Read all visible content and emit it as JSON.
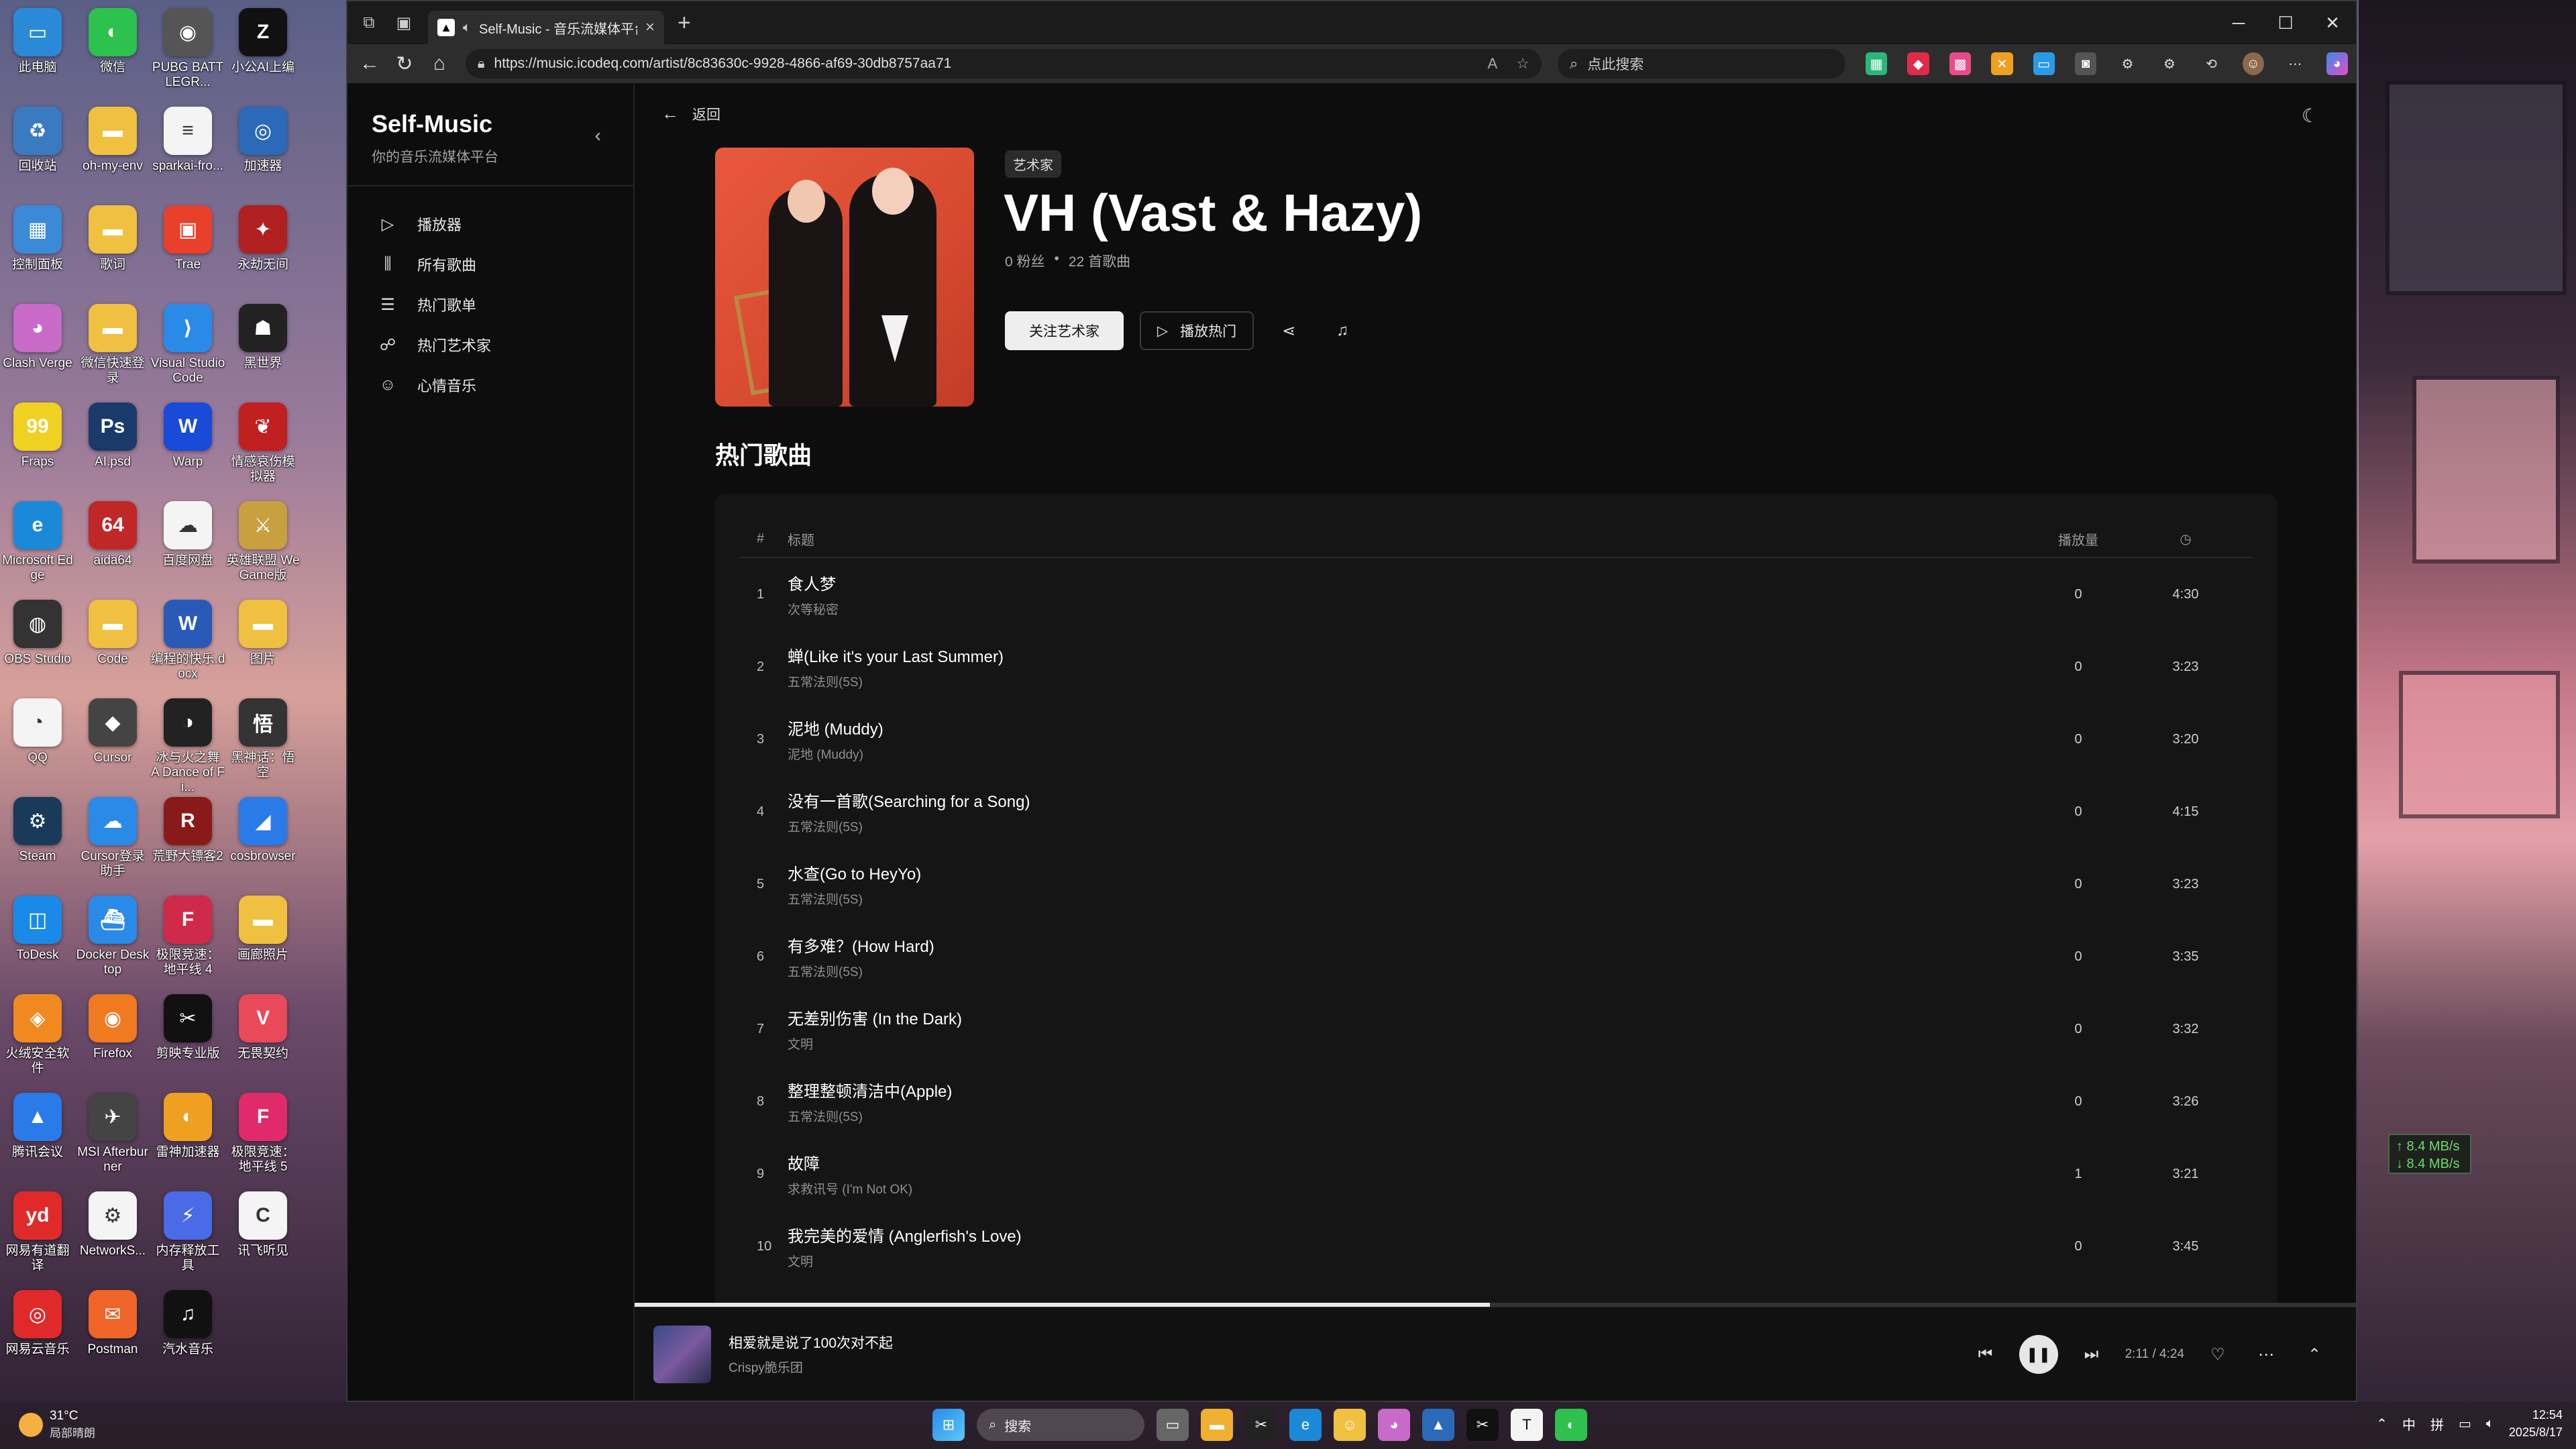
{
  "browser": {
    "tab_title": "Self-Music - 音乐流媒体平台",
    "url": "https://music.icodeq.com/artist/8c83630c-9928-4866-af69-30db8757aa71",
    "search_placeholder": "点此搜索"
  },
  "sidebar": {
    "brand": "Self-Music",
    "tagline": "你的音乐流媒体平台",
    "items": [
      {
        "label": "播放器"
      },
      {
        "label": "所有歌曲"
      },
      {
        "label": "热门歌单"
      },
      {
        "label": "热门艺术家"
      },
      {
        "label": "心情音乐"
      }
    ]
  },
  "artist": {
    "back_label": "返回",
    "badge": "艺术家",
    "name": "VH (Vast & Hazy)",
    "followers": "0 粉丝",
    "separator": "•",
    "song_count": "22 首歌曲",
    "follow_label": "关注艺术家",
    "play_label": "播放热门"
  },
  "songs": {
    "section_title": "热门歌曲",
    "headers": {
      "num": "#",
      "title": "标题",
      "plays": "播放量"
    },
    "rows": [
      {
        "num": "1",
        "title": "食人梦",
        "artist": "次等秘密",
        "plays": "0",
        "duration": "4:30"
      },
      {
        "num": "2",
        "title": "蝉(Like it's your Last Summer)",
        "artist": "五常法则(5S)",
        "plays": "0",
        "duration": "3:23"
      },
      {
        "num": "3",
        "title": "泥地 (Muddy)",
        "artist": "泥地 (Muddy)",
        "plays": "0",
        "duration": "3:20"
      },
      {
        "num": "4",
        "title": "没有一首歌(Searching for a Song)",
        "artist": "五常法则(5S)",
        "plays": "0",
        "duration": "4:15"
      },
      {
        "num": "5",
        "title": "水查(Go to HeyYo)",
        "artist": "五常法则(5S)",
        "plays": "0",
        "duration": "3:23"
      },
      {
        "num": "6",
        "title": "有多难？(How Hard)",
        "artist": "五常法则(5S)",
        "plays": "0",
        "duration": "3:35"
      },
      {
        "num": "7",
        "title": "无差别伤害 (In the Dark)",
        "artist": "文明",
        "plays": "0",
        "duration": "3:32"
      },
      {
        "num": "8",
        "title": "整理整顿清洁中(Apple)",
        "artist": "五常法则(5S)",
        "plays": "0",
        "duration": "3:26"
      },
      {
        "num": "9",
        "title": "故障",
        "artist": "求救讯号 (I'm Not OK)",
        "plays": "1",
        "duration": "3:21"
      },
      {
        "num": "10",
        "title": "我完美的爱情 (Anglerfish's Love)",
        "artist": "文明",
        "plays": "0",
        "duration": "3:45"
      }
    ]
  },
  "player": {
    "title": "相爱就是说了100次对不起",
    "artist": "Crispy脆乐团",
    "time": "2:11 / 4:24",
    "progress_fraction": 0.497
  },
  "desktop": {
    "icons": [
      {
        "label": "此电脑",
        "color": "#2a8ad8",
        "glyph": "▭"
      },
      {
        "label": "微信",
        "color": "#2dc14e",
        "glyph": "◐"
      },
      {
        "label": "PUBG BATTLEGR...",
        "color": "#555",
        "glyph": "◉"
      },
      {
        "label": "小公AI上编",
        "color": "#111",
        "glyph": "Z"
      },
      {
        "label": "回收站",
        "color": "#3a7ac0",
        "glyph": "♻"
      },
      {
        "label": "oh-my-env",
        "color": "#f0c040",
        "glyph": "▬"
      },
      {
        "label": "sparkai-fro...",
        "color": "#f4f4f4",
        "glyph": "≡"
      },
      {
        "label": "加速器",
        "color": "#2a6ab8",
        "glyph": "◎"
      },
      {
        "label": "控制面板",
        "color": "#3a8ad8",
        "glyph": "▦"
      },
      {
        "label": "歌词",
        "color": "#f0c040",
        "glyph": "▬"
      },
      {
        "label": "Trae",
        "color": "#e8402a",
        "glyph": "▣"
      },
      {
        "label": "永劫无间",
        "color": "#b02020",
        "glyph": "✦"
      },
      {
        "label": "Clash Verge",
        "color": "#c86ac8",
        "glyph": "◕"
      },
      {
        "label": "微信快速登录",
        "color": "#f0c040",
        "glyph": "▬"
      },
      {
        "label": "Visual Studio Code",
        "color": "#2a8ae8",
        "glyph": "⟩"
      },
      {
        "label": "黑世界",
        "color": "#222",
        "glyph": "☗"
      },
      {
        "label": "Fraps",
        "color": "#f0d020",
        "glyph": "99"
      },
      {
        "label": "AI.psd",
        "color": "#1a3a6a",
        "glyph": "Ps"
      },
      {
        "label": "Warp",
        "color": "#1a4ad8",
        "glyph": "W"
      },
      {
        "label": "情感哀伤模拟器",
        "color": "#c02020",
        "glyph": "❦"
      },
      {
        "label": "Microsoft Edge",
        "color": "#1a8ad8",
        "glyph": "e"
      },
      {
        "label": "aida64",
        "color": "#c02828",
        "glyph": "64"
      },
      {
        "label": "百度网盘",
        "color": "#f4f4f4",
        "glyph": "☁"
      },
      {
        "label": "英雄联盟 WeGame版",
        "color": "#c8a040",
        "glyph": "⚔"
      },
      {
        "label": "OBS Studio",
        "color": "#333",
        "glyph": "◍"
      },
      {
        "label": "Code",
        "color": "#f0c040",
        "glyph": "▬"
      },
      {
        "label": "编程的快乐.docx",
        "color": "#2a5ab8",
        "glyph": "W"
      },
      {
        "label": "图片",
        "color": "#f0c040",
        "glyph": "▬"
      },
      {
        "label": "QQ",
        "color": "#f4f4f4",
        "glyph": "◔"
      },
      {
        "label": "Cursor",
        "color": "#444",
        "glyph": "◆"
      },
      {
        "label": "冰与火之舞 A Dance of Fi...",
        "color": "#222",
        "glyph": "◑"
      },
      {
        "label": "黑神话：悟空",
        "color": "#333",
        "glyph": "悟"
      },
      {
        "label": "Steam",
        "color": "#1a3a5a",
        "glyph": "⚙"
      },
      {
        "label": "Cursor登录助手",
        "color": "#2a8ae8",
        "glyph": "☁"
      },
      {
        "label": "荒野大镖客2",
        "color": "#8a1a1a",
        "glyph": "R"
      },
      {
        "label": "cosbrowser",
        "color": "#2a7ae8",
        "glyph": "◢"
      },
      {
        "label": "ToDesk",
        "color": "#1a8ae8",
        "glyph": "◫"
      },
      {
        "label": "Docker Desktop",
        "color": "#2a8ae8",
        "glyph": "⛴"
      },
      {
        "label": "极限竞速：地平线 4",
        "color": "#d02a4a",
        "glyph": "F"
      },
      {
        "label": "画廊照片",
        "color": "#f0c040",
        "glyph": "▬"
      },
      {
        "label": "火绒安全软件",
        "color": "#f08a20",
        "glyph": "◈"
      },
      {
        "label": "Firefox",
        "color": "#f07a20",
        "glyph": "◉"
      },
      {
        "label": "剪映专业版",
        "color": "#111",
        "glyph": "✂"
      },
      {
        "label": "无畏契约",
        "color": "#e84a5a",
        "glyph": "V"
      },
      {
        "label": "腾讯会议",
        "color": "#2a7ae8",
        "glyph": "▲"
      },
      {
        "label": "MSI Afterburner",
        "color": "#444",
        "glyph": "✈"
      },
      {
        "label": "雷神加速器",
        "color": "#f0a020",
        "glyph": "◐"
      },
      {
        "label": "极限竞速：地平线 5",
        "color": "#e02a6a",
        "glyph": "F"
      },
      {
        "label": "网易有道翻译",
        "color": "#e02a2a",
        "glyph": "yd"
      },
      {
        "label": "NetworkS...",
        "color": "#f4f4f4",
        "glyph": "⚙"
      },
      {
        "label": "内存释放工具",
        "color": "#4a6ae8",
        "glyph": "⚡"
      },
      {
        "label": "讯飞听见",
        "color": "#f4f4f4",
        "glyph": "C"
      },
      {
        "label": "网易云音乐",
        "color": "#e02a2a",
        "glyph": "◎"
      },
      {
        "label": "Postman",
        "color": "#f0642a",
        "glyph": "✉"
      },
      {
        "label": "汽水音乐",
        "color": "#111",
        "glyph": "♫"
      }
    ]
  },
  "taskbar": {
    "temp": "31°C",
    "weather": "局部晴朗",
    "search": "搜索",
    "ime1": "中",
    "ime2": "拼",
    "time": "12:54",
    "date": "2025/8/17",
    "net_up": "↑ 8.4 MB/s",
    "net_down": "↓ 8.4 MB/s"
  }
}
